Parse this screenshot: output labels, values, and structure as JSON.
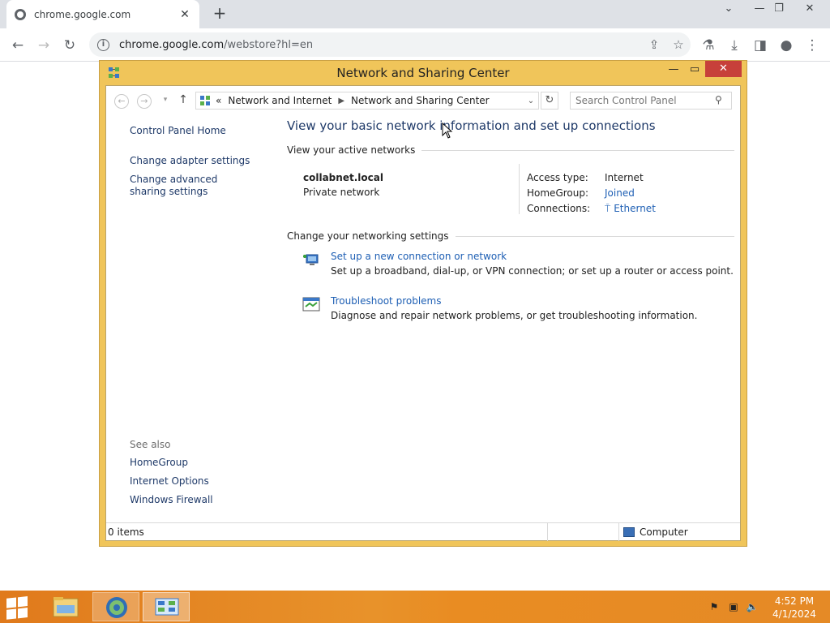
{
  "browser": {
    "tab_title": "chrome.google.com",
    "url_domain": "chrome.google.com",
    "url_path": "/webstore?hl=en"
  },
  "window": {
    "title": "Network and Sharing Center",
    "breadcrumb": {
      "prefix": "«",
      "items": [
        "Network and Internet",
        "Network and Sharing Center"
      ]
    },
    "search_placeholder": "Search Control Panel"
  },
  "sidebar": {
    "home": "Control Panel Home",
    "links": [
      "Change adapter settings",
      "Change advanced sharing settings"
    ],
    "see_also_heading": "See also",
    "see_also": [
      "HomeGroup",
      "Internet Options",
      "Windows Firewall"
    ]
  },
  "main": {
    "heading": "View your basic network information and set up connections",
    "active_networks_label": "View your active networks",
    "network": {
      "name": "collabnet.local",
      "type": "Private network",
      "access_type_label": "Access type:",
      "access_type_value": "Internet",
      "homegroup_label": "HomeGroup:",
      "homegroup_value": "Joined",
      "connections_label": "Connections:",
      "connections_value": "Ethernet"
    },
    "settings_label": "Change your networking settings",
    "tasks": [
      {
        "title": "Set up a new connection or network",
        "desc": "Set up a broadband, dial-up, or VPN connection; or set up a router or access point.",
        "icon": "network-setup-icon"
      },
      {
        "title": "Troubleshoot problems",
        "desc": "Diagnose and repair network problems, or get troubleshooting information.",
        "icon": "troubleshoot-icon"
      }
    ]
  },
  "statusbar": {
    "items": "0 items",
    "zone": "Computer"
  },
  "taskbar": {
    "time": "4:52 PM",
    "date": "4/1/2024"
  },
  "colors": {
    "dialog_frame": "#f0c55a",
    "link": "#1e3968",
    "taskbar": "#e8922a",
    "close_button": "#c7403a"
  }
}
